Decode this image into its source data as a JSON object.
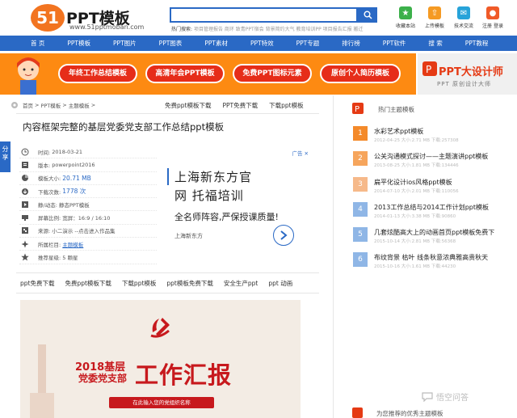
{
  "header": {
    "logo_number": "51",
    "logo_title": "PPT模板",
    "logo_url": "www.51pptmoban.com",
    "search_placeholder": "",
    "hot_label": "热门搜索:",
    "hot_terms": "项目管理报告 商环 致青PPT宿会 背景简约大气 教育培训PP 项目报告汇报 搬迁",
    "tools": [
      {
        "label": "收藏本站",
        "color": "#3cb04a",
        "icon": "star-icon"
      },
      {
        "label": "上传模板",
        "color": "#f59a23",
        "icon": "upload-icon"
      },
      {
        "label": "技术交流",
        "color": "#27a3d9",
        "icon": "chat-icon"
      },
      {
        "label": "注册 登录",
        "color": "#f05a28",
        "icon": "user-icon"
      }
    ]
  },
  "nav": [
    "首 页",
    "PPT模板",
    "PPT图片",
    "PPT图表",
    "PPT素材",
    "PPT特效",
    "PPT专题",
    "排行榜",
    "PPT软件",
    "搜 索",
    "PPT教程"
  ],
  "banner": {
    "buttons": [
      "年终工作总结模板",
      "高清年会PPT模板",
      "免费PPT图标元素",
      "原创个人简历模板"
    ],
    "right_title": "PPT大设计师",
    "right_sub": "PPT 原创设计大师"
  },
  "breadcrumb": [
    "首页",
    "PPT模板",
    "主题模板"
  ],
  "crumb_links": [
    "免费ppt模板下载",
    "PPT免费下载",
    "下载ppt模板"
  ],
  "page_title": "内容框架完整的基层党委党支部工作总结ppt模板",
  "share_label": "分享",
  "info": [
    {
      "label": "时间:",
      "value": "2018-03-21",
      "icon": "clock-icon"
    },
    {
      "label": "版本:",
      "value": "powerpoint2016",
      "icon": "version-icon"
    },
    {
      "label": "模板大小:",
      "value": "20.71 MB",
      "icon": "pie-icon",
      "highlight": true
    },
    {
      "label": "下载次数:",
      "value": "1778 次",
      "icon": "download-icon",
      "highlight": true
    },
    {
      "label": "静/动态:",
      "value": "静态PPT模板",
      "icon": "play-icon"
    },
    {
      "label": "屏幕比例:",
      "value": "宽屏：16:9 / 16:10",
      "icon": "screen-icon"
    },
    {
      "label": "来源:",
      "value": "小二演示 --点击进入作品集",
      "icon": "source-icon"
    },
    {
      "label": "所属栏目:",
      "value": "主题模板",
      "icon": "category-icon",
      "link": true
    },
    {
      "label": "推荐星级:",
      "value": "5 颗星",
      "icon": "star-rating-icon"
    }
  ],
  "ad": {
    "label": "广告",
    "line1": "上海新东方官",
    "line2": "网 托福培训",
    "line3": "全名师阵容,严保授课质量!",
    "source": "上海新东方"
  },
  "tags": [
    "ppt免费下载",
    "免费ppt模板下载",
    "下载ppt模板",
    "ppt模板免费下载",
    "安全生产ppt",
    "ppt 动画"
  ],
  "preview": {
    "year_text": "2018基层",
    "org_text": "党委党支部",
    "main_text": "工作汇报",
    "placeholder": "在此输入您的党组织名称"
  },
  "sidebar": {
    "heading": "热门主题模板",
    "items": [
      {
        "num": "1",
        "title": "水彩艺术ppt模板",
        "meta": "2012-04-25 大小:2.71 MB 下载:257308"
      },
      {
        "num": "2",
        "title": "公关沟通模式探讨——主题演讲ppt模板",
        "meta": "2013-08-25 大小:1.81 MB 下载:134446"
      },
      {
        "num": "3",
        "title": "扁平化设计ios风格ppt模板",
        "meta": "2014-07-10 大小:2.01 MB 下载:110056"
      },
      {
        "num": "4",
        "title": "2013工作总结与2014工作计划ppt模板",
        "meta": "2014-01-13 大小:3.38 MB 下载:90860"
      },
      {
        "num": "5",
        "title": "几套炫酷高大上的动画首页ppt模板免费下",
        "meta": "2015-10-14 大小:2.81 MB 下载:56368"
      },
      {
        "num": "6",
        "title": "布纹背景 枯叶 线条秋意浓典雅高贵秋天",
        "meta": "2015-10-16 大小:1.61 MB 下载:44230"
      }
    ],
    "number_colors": [
      "#f48a2a",
      "#f6a55c",
      "#f6b98a",
      "#8fb6e6",
      "#8fb6e6",
      "#8fb6e6"
    ],
    "bottom": "为您推荐的优秀主题模板"
  },
  "watermark": "悟空问答"
}
